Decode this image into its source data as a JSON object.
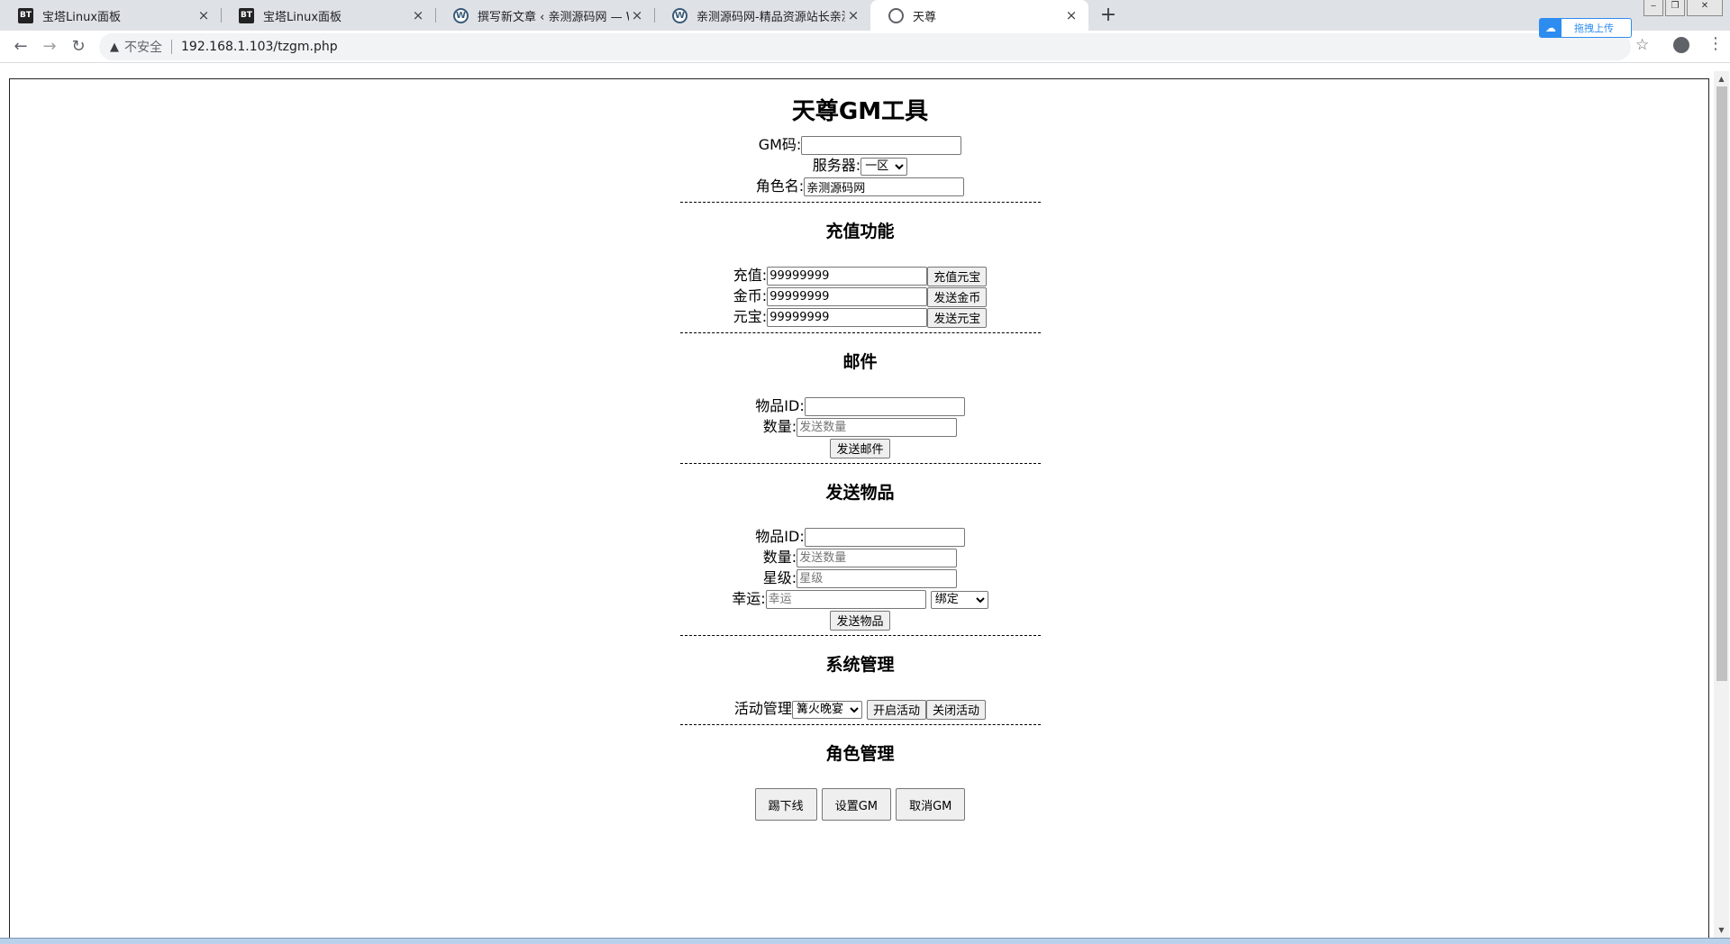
{
  "browser": {
    "tabs": [
      {
        "title": "宝塔Linux面板",
        "favicon": "BT",
        "favicon_type": "bt"
      },
      {
        "title": "宝塔Linux面板",
        "favicon": "BT",
        "favicon_type": "bt"
      },
      {
        "title": "撰写新文章 ‹ 亲测源码网 — Wo",
        "favicon": "W",
        "favicon_type": "wp"
      },
      {
        "title": "亲测源码网-精品资源站长亲测",
        "favicon": "W",
        "favicon_type": "wp"
      },
      {
        "title": "天尊",
        "favicon": "",
        "favicon_type": "globe"
      }
    ],
    "close_glyph": "×",
    "new_tab_glyph": "+",
    "security_label": "不安全",
    "url": "192.168.1.103/tzgm.php",
    "upload_label": "拖拽上传"
  },
  "page": {
    "title": "天尊GM工具",
    "login": {
      "gm_code_label": "GM码:",
      "gm_code_value": "",
      "server_label": "服务器:",
      "server_selected": "一区",
      "role_label": "角色名:",
      "role_value": "亲测源码网"
    },
    "recharge": {
      "heading": "充值功能",
      "recharge_label": "充值:",
      "recharge_value": "99999999",
      "recharge_button": "充值元宝",
      "gold_label": "金币:",
      "gold_value": "99999999",
      "gold_button": "发送金币",
      "yuanbao_label": "元宝:",
      "yuanbao_value": "99999999",
      "yuanbao_button": "发送元宝"
    },
    "mail": {
      "heading": "邮件",
      "item_id_label": "物品ID:",
      "item_id_value": "",
      "qty_label": "数量:",
      "qty_placeholder": "发送数量",
      "send_button": "发送邮件"
    },
    "send_item": {
      "heading": "发送物品",
      "item_id_label": "物品ID:",
      "item_id_value": "",
      "qty_label": "数量:",
      "qty_placeholder": "发送数量",
      "star_label": "星级:",
      "star_placeholder": "星级",
      "luck_label": "幸运:",
      "luck_placeholder": "幸运",
      "bind_selected": "绑定",
      "send_button": "发送物品"
    },
    "system": {
      "heading": "系统管理",
      "activity_label": "活动管理",
      "activity_selected": "篝火晚宴",
      "open_button": "开启活动",
      "close_button": "关闭活动"
    },
    "role_admin": {
      "heading": "角色管理",
      "kick_button": "踢下线",
      "set_gm_button": "设置GM",
      "cancel_gm_button": "取消GM"
    }
  }
}
